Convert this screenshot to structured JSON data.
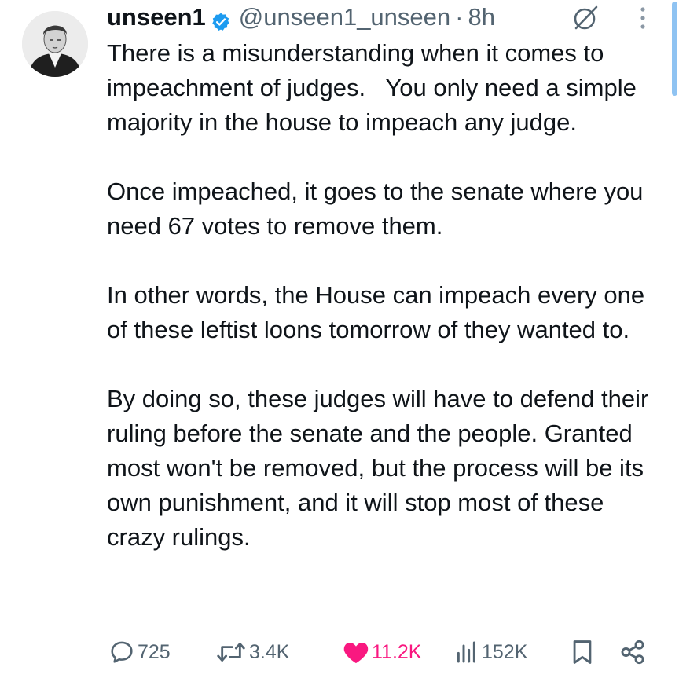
{
  "post": {
    "display_name": "unseen1",
    "handle": "@unseen1_unseen",
    "separator": "·",
    "time": "8h",
    "paragraphs": [
      "There is a misunderstanding when it comes to impeachment of judges.   You only need a simple majority in the house to impeach any judge.",
      "Once impeached, it goes to the senate where you need 67 votes to remove them.",
      "In other words, the House can impeach every one of these leftist loons tomorrow of they wanted to.",
      "By doing so, these judges will have to defend their ruling before the senate and the people. Granted most won't be removed, but the process will be its own punishment, and it will stop most of these  crazy rulings."
    ]
  },
  "actions": {
    "replies": "725",
    "reposts": "3.4K",
    "likes": "11.2K",
    "views": "152K"
  },
  "icons": {
    "avatar": "portrait-avatar",
    "verified": "verified-badge-icon",
    "grok": "grok-icon",
    "more": "more-vertical-icon",
    "reply": "reply-icon",
    "repost": "repost-icon",
    "like": "heart-icon",
    "views": "views-icon",
    "bookmark": "bookmark-icon",
    "share": "share-icon"
  },
  "colors": {
    "text": "#0f1419",
    "secondary": "#536471",
    "verified": "#1d9bf0",
    "like": "#f91880"
  }
}
